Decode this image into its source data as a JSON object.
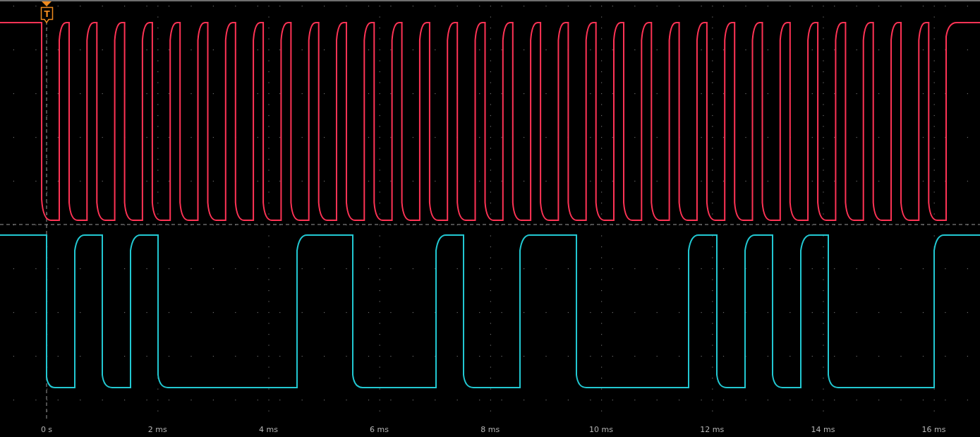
{
  "trigger": {
    "label": "T"
  },
  "channels": [
    {
      "color": "#ff3355"
    },
    {
      "color": "#22c8d2"
    }
  ],
  "time_axis": {
    "labels": [
      "0 s",
      "2 ms",
      "4 ms",
      "6 ms",
      "8 ms",
      "10 ms",
      "12 ms",
      "14 ms",
      "16 ms"
    ]
  }
}
